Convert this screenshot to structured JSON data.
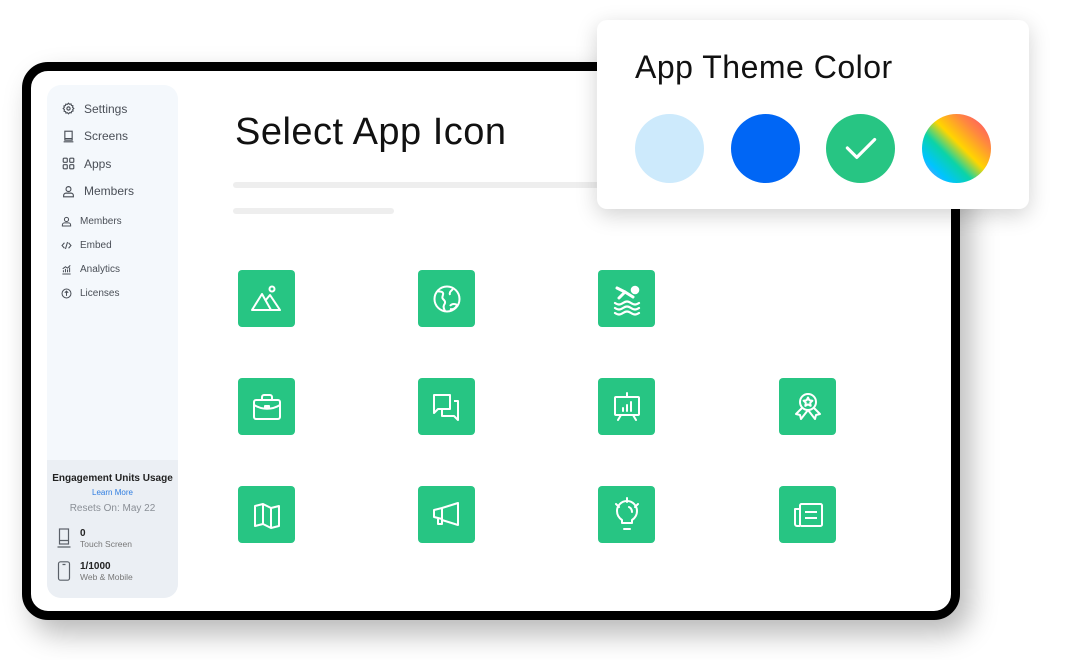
{
  "sidebar": {
    "primary_items": [
      {
        "label": "Settings",
        "icon": "gear-icon"
      },
      {
        "label": "Screens",
        "icon": "screen-icon"
      },
      {
        "label": "Apps",
        "icon": "apps-grid-icon"
      },
      {
        "label": "Members",
        "icon": "user-icon"
      }
    ],
    "secondary_items": [
      {
        "label": "Members",
        "icon": "user-icon"
      },
      {
        "label": "Embed",
        "icon": "code-icon"
      },
      {
        "label": "Analytics",
        "icon": "analytics-icon"
      },
      {
        "label": "Licenses",
        "icon": "upload-circle-icon"
      }
    ],
    "usage": {
      "title": "Engagement Units Usage",
      "learn_more": "Learn More",
      "resets": "Resets On: May 22",
      "meters": [
        {
          "value": "0",
          "label": "Touch Screen",
          "icon": "kiosk-icon"
        },
        {
          "value": "1/1000",
          "label": "Web & Mobile",
          "icon": "phone-icon"
        }
      ]
    }
  },
  "main": {
    "title": "Select App Icon",
    "icon_color": "#27c583",
    "icons": [
      {
        "name": "landscape-icon"
      },
      {
        "name": "globe-icon"
      },
      {
        "name": "swimmer-icon"
      },
      {
        "name": "briefcase-icon"
      },
      {
        "name": "chat-icon"
      },
      {
        "name": "presentation-icon"
      },
      {
        "name": "award-icon"
      },
      {
        "name": "map-icon"
      },
      {
        "name": "megaphone-icon"
      },
      {
        "name": "lightbulb-icon"
      },
      {
        "name": "newspaper-icon"
      }
    ]
  },
  "theme_popup": {
    "title": "App Theme Color",
    "swatches": [
      {
        "name": "light-blue",
        "color": "#cdeafc",
        "selected": false
      },
      {
        "name": "blue",
        "color": "#0066f5",
        "selected": false
      },
      {
        "name": "green",
        "color": "#27c583",
        "selected": true
      },
      {
        "name": "rainbow",
        "color": "gradient",
        "selected": false
      }
    ]
  }
}
